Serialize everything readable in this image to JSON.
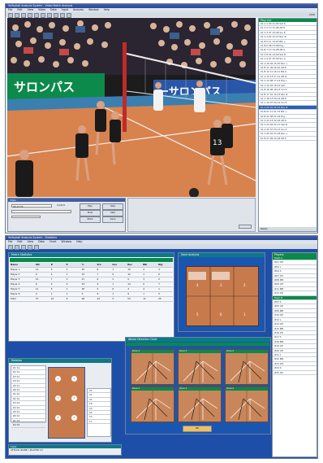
{
  "top_app": {
    "title": "Volleyball Analysis System - Video Match Analysis",
    "menu": [
      "File",
      "Edit",
      "View",
      "Video",
      "Data",
      "Input",
      "Analysis",
      "Window",
      "Help"
    ],
    "right_indicator": "DVD",
    "banner_left": "サロンパス",
    "banner_right": "ーサロンパス",
    "video_controls": {
      "title": "Video",
      "tab": "Control",
      "counter": "00:12:34",
      "buttons": [
        "Play",
        "Stop",
        "Slow",
        "Skip",
        "Mark",
        "Save"
      ]
    },
    "list_panel": {
      "header": "Play List",
      "rows": [
        "S1 A  1  04 11-05 Set K",
        "S1 A  2  13 11-06 Att P",
        "S1 A  3  07 12-06 Srv E",
        "S1 A  4  02 12-07 Rec #",
        "S1 B  5  11 13-07 Blk +",
        "S1 B  6  08 13-08 Dig -",
        "S1 B  7  13 14-08 Att K",
        "S1 A  8  04 14-09 Set #",
        "S1 A  9  07 15-09 Srv A",
        "S1 A 10  02 15-10 Rec +",
        "S1 B 11  09 16-10 Att E",
        "S1 B 12  11 16-11 Blk K",
        "S1 A 13  13 17-11 Att #",
        "S1 A 14  08 17-12 Dig +",
        "S1 A 15  04 18-12 Set -",
        "S1 B 16  06 18-13 Srv K",
        "S1 B 17  01 19-13 Rec #",
        "S1 A 18  13 19-14 Att P",
        "S1 A 19  07 20-14 Srv E",
        "S1 A 20  02 20-15 Rec #",
        "S1 B 21  11 21-15 Blk +",
        "S1 B 22  08 21-16 Dig -",
        "S1 A 23  13 22-16 Att K",
        "S1 A 24  04 22-17 Set #",
        "S1 A 25  07 23-17 Srv A",
        "S1 A 26  02 23-18 Rec +",
        "S1 B 27  09 24-18 Att E"
      ],
      "selected_index": 19,
      "footer": "Ready"
    }
  },
  "bottom_app": {
    "title": "Volleyball Analysis System - Statistics",
    "menu": [
      "File",
      "Edit",
      "View",
      "Data",
      "Chart",
      "Window",
      "Help"
    ],
    "stats_window": {
      "title": "Match Statistics",
      "columns": [
        "Name",
        "Att",
        "K",
        "E",
        "%",
        "Srv",
        "Ace",
        "Rec",
        "Blk",
        "Dig"
      ],
      "rows": [
        [
          "Player 1",
          "12",
          "5",
          "2",
          "25",
          "8",
          "1",
          "10",
          "2",
          "4"
        ],
        [
          "Player 2",
          "9",
          "4",
          "1",
          "33",
          "7",
          "0",
          "12",
          "1",
          "6"
        ],
        [
          "Player 3",
          "15",
          "7",
          "3",
          "27",
          "6",
          "2",
          "5",
          "3",
          "2"
        ],
        [
          "Player 4",
          "6",
          "2",
          "0",
          "33",
          "9",
          "1",
          "14",
          "0",
          "7"
        ],
        [
          "Player 5",
          "11",
          "5",
          "1",
          "36",
          "5",
          "0",
          "3",
          "4",
          "1"
        ],
        [
          "Player 6",
          "4",
          "1",
          "1",
          "0",
          "8",
          "1",
          "9",
          "1",
          "5"
        ],
        [
          "Total",
          "57",
          "24",
          "8",
          "28",
          "43",
          "5",
          "53",
          "11",
          "25"
        ]
      ]
    },
    "zone_window": {
      "title": "Zone Analysis",
      "zones": [
        "4",
        "3",
        "2",
        "5",
        "6",
        "1"
      ]
    },
    "rotation_window": {
      "title": "Rotation",
      "players": [
        "1",
        "2",
        "3",
        "4",
        "5",
        "6"
      ],
      "list": [
        "R1 S1",
        "R2 S1",
        "R3 S1",
        "R4 S1",
        "R5 S1",
        "R6 S1",
        "R1 S2",
        "R2 S2",
        "R3 S2",
        "R4 S2",
        "R5 S2",
        "R6 S2",
        "R1 S3",
        "R2 S3"
      ],
      "score_panel": [
        "25",
        "21",
        "25",
        "18",
        "23",
        "25",
        "15",
        "11"
      ],
      "footer_label": "Input",
      "footer_value": "ATTACK ZONE / PLAYER 13"
    },
    "chart_window": {
      "title": "Attack Direction Chart",
      "tabs": [
        "A",
        "B",
        "C"
      ],
      "chart_labels": [
        "Zone 4",
        "Zone 3",
        "Zone 2",
        "Zone 4",
        "Zone 3",
        "Zone 2"
      ],
      "ok_label": "OK"
    },
    "right_list": {
      "header": "Players",
      "items": [
        "Team A",
        "#01 OH",
        "#02 L",
        "#04 S",
        "#07 OP",
        "#08 MB",
        "#09 OH",
        "#11 MB",
        "#13 OH",
        "Team B",
        "#03 S",
        "#05 OH",
        "#06 MB",
        "#10 OP",
        "#12 L",
        "#14 OH",
        "#15 MB",
        "#16 OH",
        "#17 S",
        "#18 MB",
        "#19 OP",
        "#20 OH",
        "#21 L",
        "#22 MB",
        "#23 OH",
        "#24 S",
        "#25 OP"
      ]
    }
  }
}
